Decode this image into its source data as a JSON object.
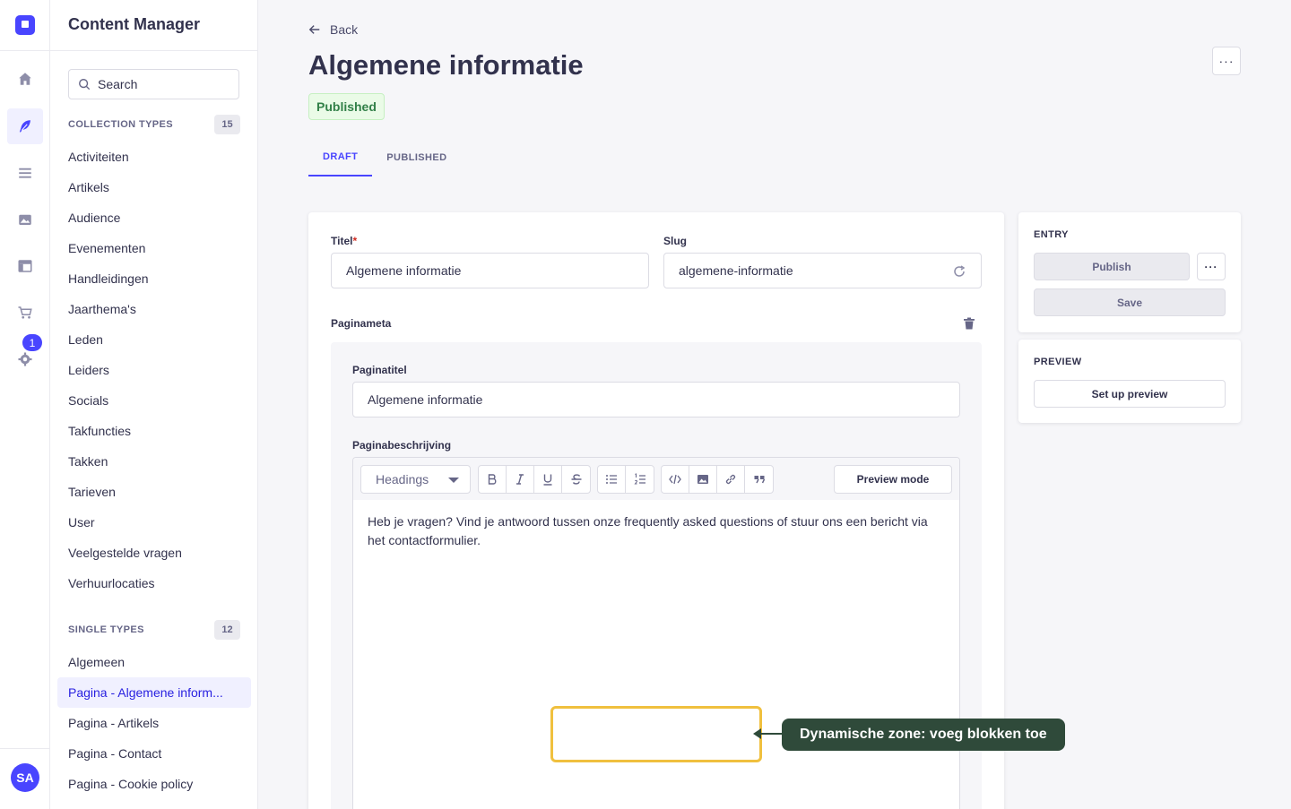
{
  "rail": {
    "notification_badge": "1",
    "avatar_initials": "SA",
    "accent_color": "#4945ff"
  },
  "subnav": {
    "title": "Content Manager",
    "search_placeholder": "Search",
    "collection_types": {
      "label": "COLLECTION TYPES",
      "count": "15",
      "items": [
        "Activiteiten",
        "Artikels",
        "Audience",
        "Evenementen",
        "Handleidingen",
        "Jaarthema's",
        "Leden",
        "Leiders",
        "Socials",
        "Takfuncties",
        "Takken",
        "Tarieven",
        "User",
        "Veelgestelde vragen",
        "Verhuurlocaties"
      ]
    },
    "single_types": {
      "label": "SINGLE TYPES",
      "count": "12",
      "items": [
        "Algemeen",
        "Pagina - Algemene inform...",
        "Pagina - Artikels",
        "Pagina - Contact",
        "Pagina - Cookie policy"
      ],
      "active_index": 1
    }
  },
  "header": {
    "back_label": "Back",
    "title": "Algemene informatie",
    "more_label": "···",
    "status": "Published",
    "status_color": "#328048"
  },
  "tabs": [
    {
      "label": "DRAFT",
      "active": true
    },
    {
      "label": "PUBLISHED",
      "active": false
    }
  ],
  "form": {
    "titel": {
      "label": "Titel",
      "required_mark": "*",
      "value": "Algemene informatie"
    },
    "slug": {
      "label": "Slug",
      "value": "algemene-informatie"
    },
    "component_label": "Paginameta",
    "paginatitel": {
      "label": "Paginatitel",
      "value": "Algemene informatie"
    },
    "paginabeschrijving": {
      "label": "Paginabeschrijving",
      "headings_select": "Headings",
      "preview_mode_label": "Preview mode",
      "content": "Heb je vragen? Vind je antwoord tussen onze frequently asked questions of stuur ons een bericht via het contactformulier."
    }
  },
  "entry": {
    "label": "ENTRY",
    "publish_label": "Publish",
    "more_label": "···",
    "save_label": "Save"
  },
  "preview": {
    "label": "PREVIEW",
    "button_label": "Set up preview"
  },
  "annotation": {
    "text": "Dynamische zone: voeg blokken toe",
    "highlight_color": "#f0c03e",
    "callout_color": "#2f4a3a"
  }
}
